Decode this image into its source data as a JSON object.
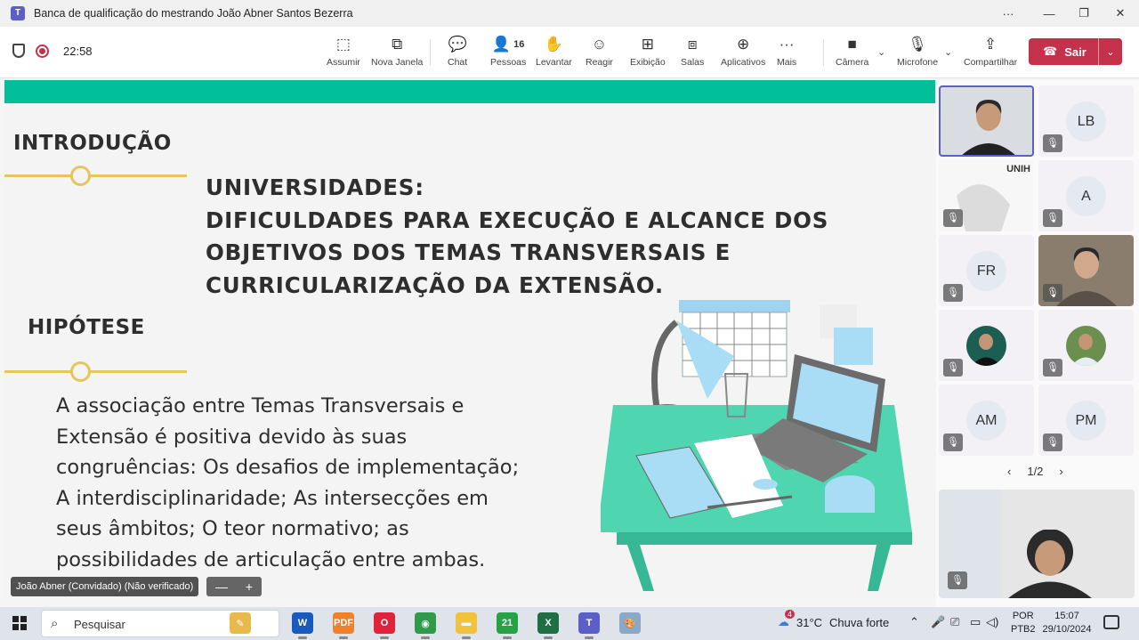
{
  "window": {
    "title": "Banca de qualificação do mestrando João Abner Santos Bezerra",
    "controls": {
      "more": "···",
      "minimize": "—",
      "restore": "❐",
      "close": "✕"
    }
  },
  "meeting": {
    "elapsed_time": "22:58",
    "toolbar": [
      {
        "id": "assumir",
        "label": "Assumir",
        "icon": "take-control-icon",
        "glyph": "⬚"
      },
      {
        "id": "nova-janela",
        "label": "Nova Janela",
        "icon": "pop-out-icon",
        "glyph": "⧉"
      },
      {
        "id": "chat",
        "label": "Chat",
        "icon": "chat-icon",
        "glyph": "💬"
      },
      {
        "id": "pessoas",
        "label": "Pessoas",
        "icon": "people-icon",
        "glyph": "👤",
        "count": "16"
      },
      {
        "id": "levantar",
        "label": "Levantar",
        "icon": "raise-hand-icon",
        "glyph": "✋"
      },
      {
        "id": "reagir",
        "label": "Reagir",
        "icon": "react-icon",
        "glyph": "☺"
      },
      {
        "id": "exibicao",
        "label": "Exibição",
        "icon": "view-icon",
        "glyph": "⊞"
      },
      {
        "id": "salas",
        "label": "Salas",
        "icon": "rooms-icon",
        "glyph": "⧈"
      },
      {
        "id": "aplicativos",
        "label": "Aplicativos",
        "icon": "apps-icon",
        "glyph": "⊕"
      },
      {
        "id": "mais",
        "label": "Mais",
        "icon": "more-icon",
        "glyph": "···"
      },
      {
        "id": "camera",
        "label": "Câmera",
        "icon": "camera-icon",
        "glyph": "■"
      },
      {
        "id": "microfone",
        "label": "Microfone",
        "icon": "mic-off-icon",
        "glyph": "🎙"
      },
      {
        "id": "compartilhar",
        "label": "Compartilhar",
        "icon": "share-icon",
        "glyph": "⇪"
      }
    ],
    "leave_label": "Sair",
    "leave_color": "#c4314b",
    "presenter_name": "João Abner (Convidado) (Não verificado)",
    "zoom": {
      "minus": "—",
      "plus": "+"
    }
  },
  "slide": {
    "accent_color": "#00bf99",
    "rule_color": "#e6c65c",
    "heading1": "INTRODUÇÃO",
    "title_lines": [
      "UNIVERSIDADES:",
      "DIFICULDADES PARA EXECUÇÃO E ALCANCE DOS",
      "OBJETIVOS DOS TEMAS TRANSVERSAIS E",
      "CURRICULARIZAÇÃO DA EXTENSÃO."
    ],
    "heading2": "HIPÓTESE",
    "body_lines": [
      "A associação entre Temas Transversais e",
      "Extensão é positiva devido às suas",
      "congruências: Os desafios de implementação;",
      "A interdisciplinaridade; As intersecções em",
      "seus âmbitos; O teor normativo; as",
      "possibilidades de articulação entre ambas."
    ]
  },
  "participants": {
    "tiles": [
      {
        "kind": "video",
        "selected": true,
        "muted": false
      },
      {
        "kind": "avatar",
        "initials": "LB",
        "muted": true
      },
      {
        "kind": "video-slide",
        "muted": true,
        "logo_text": "UNIH"
      },
      {
        "kind": "avatar",
        "initials": "A",
        "muted": true
      },
      {
        "kind": "avatar",
        "initials": "FR",
        "muted": true
      },
      {
        "kind": "video",
        "muted": true
      },
      {
        "kind": "photo",
        "muted": true
      },
      {
        "kind": "photo",
        "muted": true
      },
      {
        "kind": "avatar",
        "initials": "AM",
        "muted": true
      },
      {
        "kind": "avatar",
        "initials": "PM",
        "muted": true
      }
    ],
    "page": "1/2",
    "self_view_muted": true
  },
  "taskbar": {
    "search_placeholder": "Pesquisar",
    "apps": [
      {
        "name": "copilot-icon",
        "glyph": "✎",
        "color": "#e9b949"
      },
      {
        "name": "word-icon",
        "glyph": "W",
        "color": "#185abd"
      },
      {
        "name": "pdf-icon",
        "glyph": "PDF",
        "color": "#f0802b"
      },
      {
        "name": "opera-icon",
        "glyph": "O",
        "color": "#e0223a"
      },
      {
        "name": "chrome-icon",
        "glyph": "◉",
        "color": "#2f9b4a"
      },
      {
        "name": "explorer-icon",
        "glyph": "▬",
        "color": "#f2c23c"
      },
      {
        "name": "whatsapp-icon",
        "glyph": "21",
        "color": "#25a244"
      },
      {
        "name": "excel-icon",
        "glyph": "X",
        "color": "#1d7044"
      },
      {
        "name": "teams-icon",
        "glyph": "T",
        "color": "#5b5fc7"
      },
      {
        "name": "paint-icon",
        "glyph": "🎨",
        "color": "#8aa9c8"
      }
    ],
    "weather_temp": "31°C",
    "weather_desc": "Chuva forte",
    "weather_badge": "4",
    "lang_top": "POR",
    "lang_bottom": "PTB2",
    "time": "15:07",
    "date": "29/10/2024"
  }
}
